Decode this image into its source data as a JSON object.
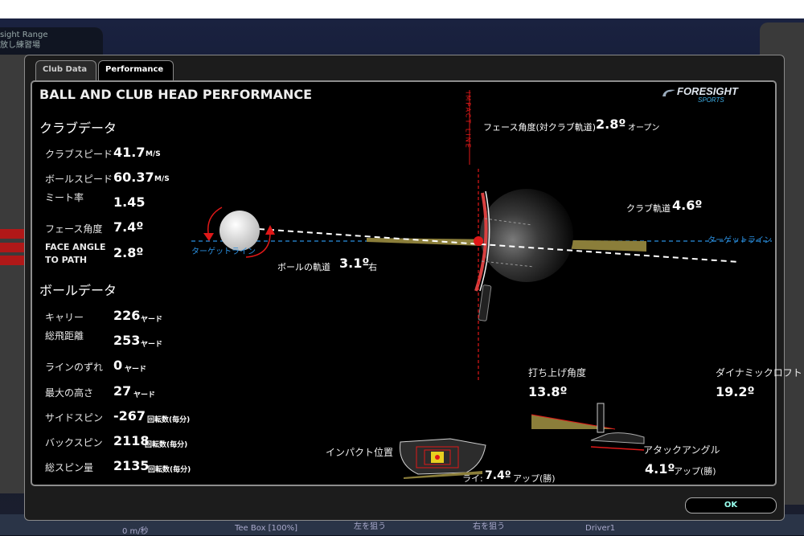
{
  "background": {
    "title_en": "sight Range",
    "title_jp": "放し練習場",
    "bottom_items": [
      "0 m/秒",
      "Tee Box [100%]",
      "左を狙う",
      "右を狙う",
      "Driver1"
    ]
  },
  "tabs": [
    {
      "label": "Club Data",
      "active": false
    },
    {
      "label": "Performance",
      "active": true
    }
  ],
  "panel": {
    "title": "BALL AND CLUB HEAD PERFORMANCE",
    "logo_main": "FORESIGHT",
    "logo_sub": "SPORTS"
  },
  "club_data": {
    "heading": "クラブデータ",
    "rows": [
      {
        "label": "クラブスピード",
        "value": "41.7",
        "unit": "M/S"
      },
      {
        "label": "ボールスピード",
        "value": "60.37",
        "unit": "M/S"
      },
      {
        "label": "ミート率",
        "value": "1.45",
        "unit": ""
      },
      {
        "label": "フェース角度",
        "value": "7.4º",
        "unit": ""
      },
      {
        "label": "FACE ANGLE\nTO PATH",
        "value": "2.8º",
        "unit": ""
      }
    ]
  },
  "ball_data": {
    "heading": "ボールデータ",
    "rows": [
      {
        "label": "キャリー",
        "value": "226",
        "unit": "ヤード"
      },
      {
        "label": "総飛距離",
        "value": "253",
        "unit": "ヤード"
      },
      {
        "label": "ラインのずれ",
        "value": "0",
        "unit": "ヤード"
      },
      {
        "label": "最大の高さ",
        "value": "27",
        "unit": "ヤード"
      },
      {
        "label": "サイドスピン",
        "value": "-267",
        "unit": "回転数(毎分)"
      },
      {
        "label": "バックスピン",
        "value": "2118",
        "unit": "回転数(毎分)"
      },
      {
        "label": "総スピン量",
        "value": "2135",
        "unit": "回転数(毎分)"
      }
    ]
  },
  "diagram": {
    "impact_line": "IMPACT LINE",
    "target_line_left": "ターゲットライン",
    "target_line_right": "ターゲットライン",
    "face_to_path_label": "フェース角度(対クラブ軌道)",
    "face_to_path_value": "2.8º",
    "face_to_path_dir": "オープン",
    "club_path_label": "クラブ軌道",
    "club_path_value": "4.6º",
    "ball_path_label": "ボールの軌道",
    "ball_path_value": "3.1º",
    "ball_path_dir": "右"
  },
  "launch": {
    "launch_label": "打ち上げ角度",
    "launch_value": "13.8º",
    "dyn_loft_label": "ダイナミックロフト",
    "dyn_loft_value": "19.2º",
    "attack_label": "アタックアングル",
    "attack_value": "4.1º",
    "attack_dir": "アップ(勝)"
  },
  "impact": {
    "label": "インパクト位置",
    "lie_label": "ライ:",
    "lie_value": "7.4º",
    "lie_dir": "アップ(勝)"
  },
  "ok_label": "OK",
  "colors": {
    "accent_red": "#e01818",
    "target_blue": "#2a8fe0",
    "path_olive": "#8b7e3a",
    "ok_text": "#9fe"
  }
}
